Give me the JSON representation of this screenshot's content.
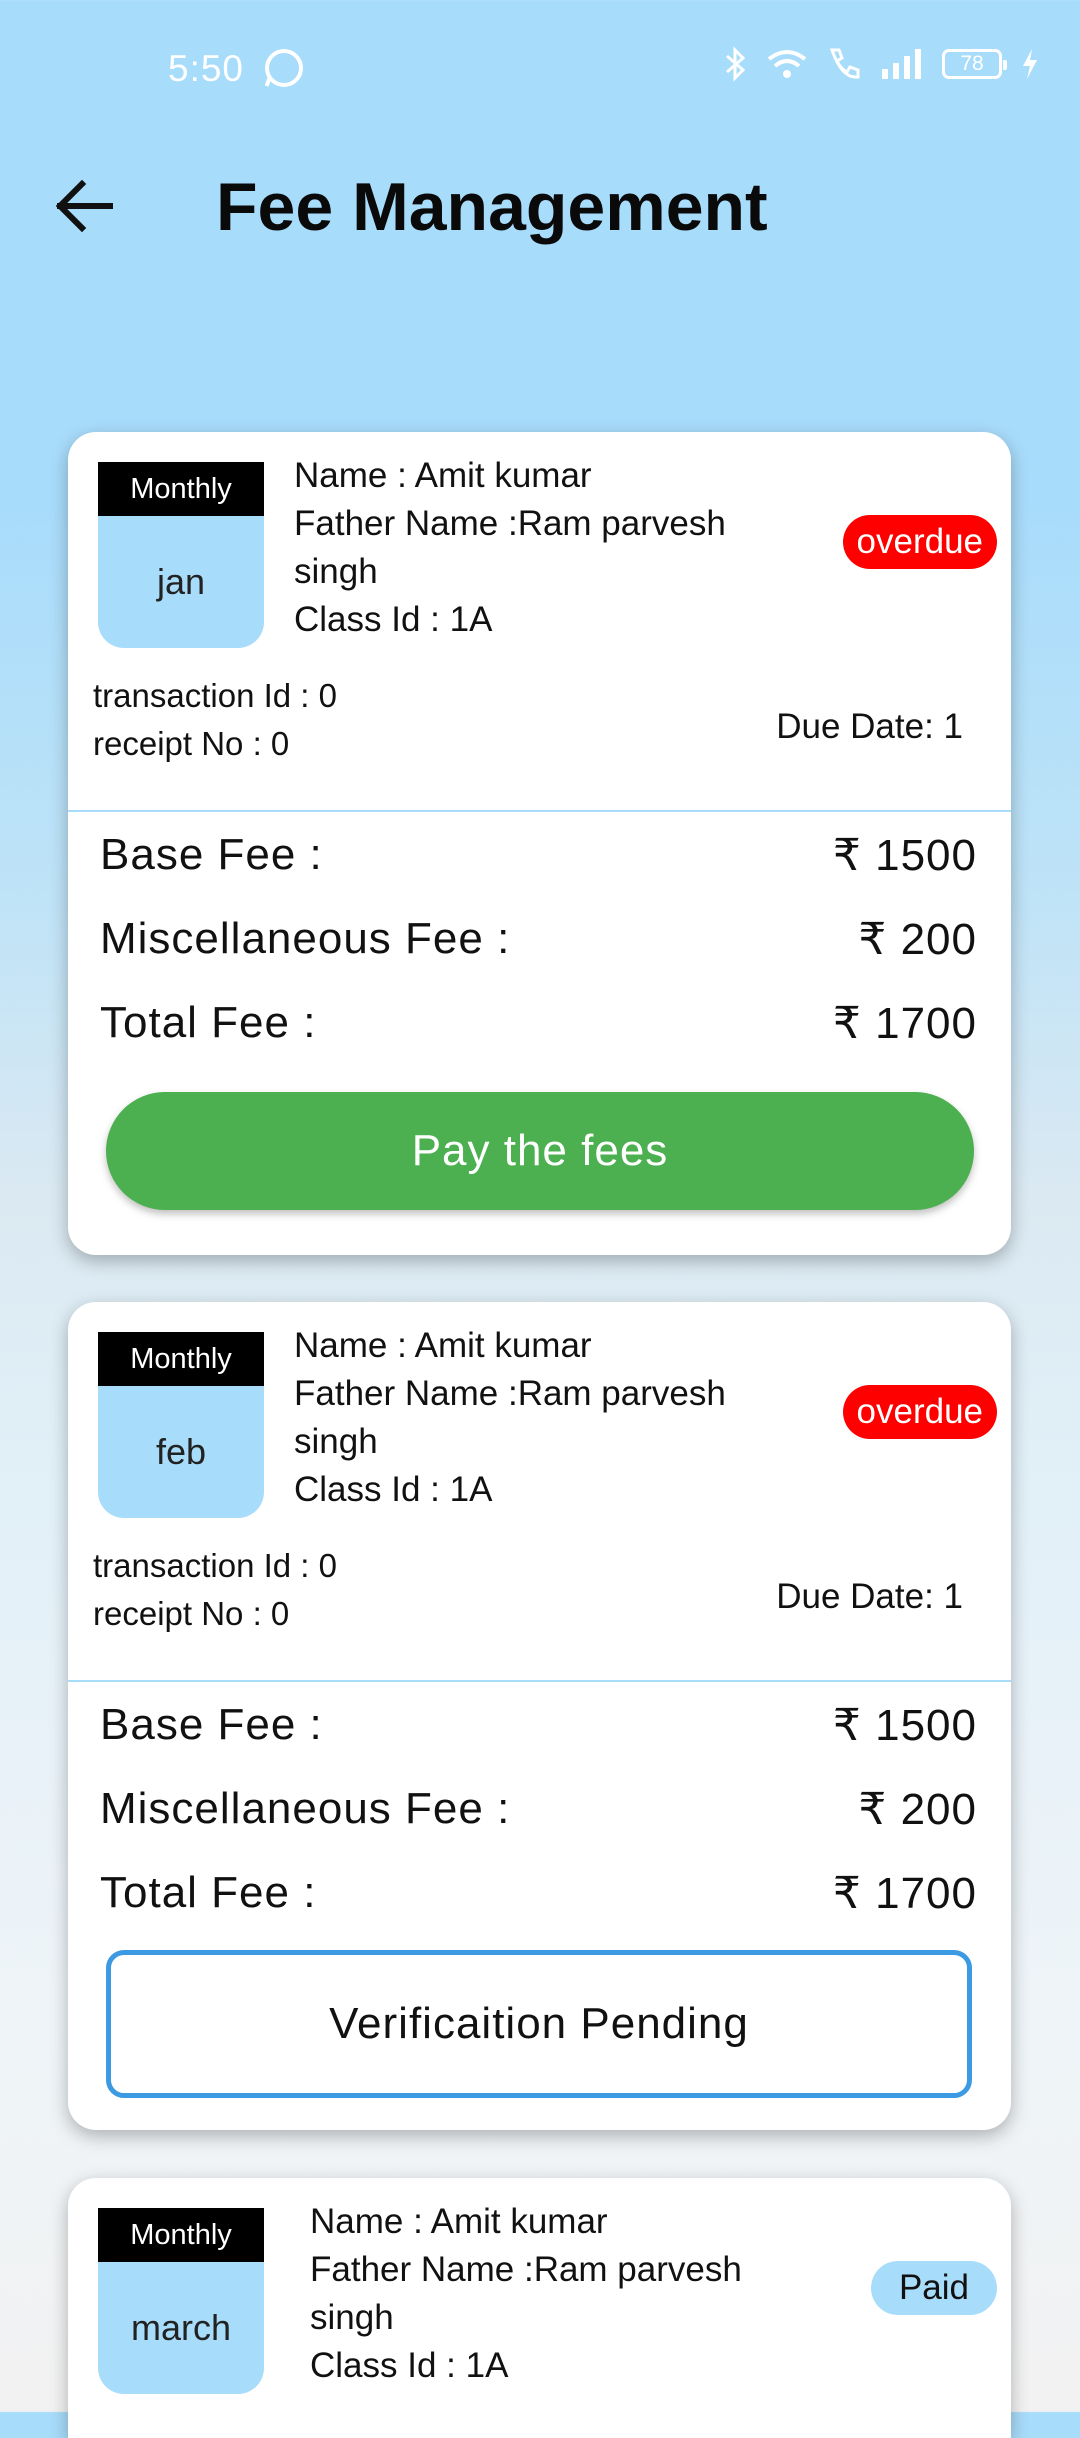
{
  "status_bar": {
    "time": "5:50",
    "battery": "78"
  },
  "app_bar": {
    "title": "Fee Management"
  },
  "cards": [
    {
      "frequency": "Monthly",
      "month": "jan",
      "name": "Name : Amit kumar",
      "father_name": "Father Name :Ram parvesh singh",
      "class_id": "Class Id : 1A",
      "status": "overdue",
      "transaction_id": "transaction Id : 0",
      "receipt_no": "receipt No : 0",
      "due_date": "Due Date: 1",
      "base_fee_label": "Base Fee :",
      "base_fee_value": "₹ 1500",
      "misc_fee_label": "Miscellaneous Fee :",
      "misc_fee_value": "₹ 200",
      "total_fee_label": "Total Fee :",
      "total_fee_value": "₹ 1700",
      "action_label": "Pay the fees"
    },
    {
      "frequency": "Monthly",
      "month": "feb",
      "name": "Name : Amit kumar",
      "father_name": "Father Name :Ram parvesh singh",
      "class_id": "Class Id : 1A",
      "status": "overdue",
      "transaction_id": "transaction Id : 0",
      "receipt_no": "receipt No : 0",
      "due_date": "Due Date: 1",
      "base_fee_label": "Base Fee :",
      "base_fee_value": "₹ 1500",
      "misc_fee_label": "Miscellaneous Fee :",
      "misc_fee_value": "₹ 200",
      "total_fee_label": "Total Fee :",
      "total_fee_value": "₹ 1700",
      "action_label": "Verificaition Pending"
    },
    {
      "frequency": "Monthly",
      "month": "march",
      "name": "Name : Amit kumar",
      "father_name": "Father Name :Ram parvesh singh",
      "class_id": "Class Id : 1A",
      "status": "Paid"
    }
  ],
  "colors": {
    "overdue": "#ff0000",
    "paid": "#a8dcfb",
    "pay_button": "#4caf50",
    "verify_border": "#3b9ae1"
  },
  "icons": {
    "back": "arrow-left-icon"
  }
}
